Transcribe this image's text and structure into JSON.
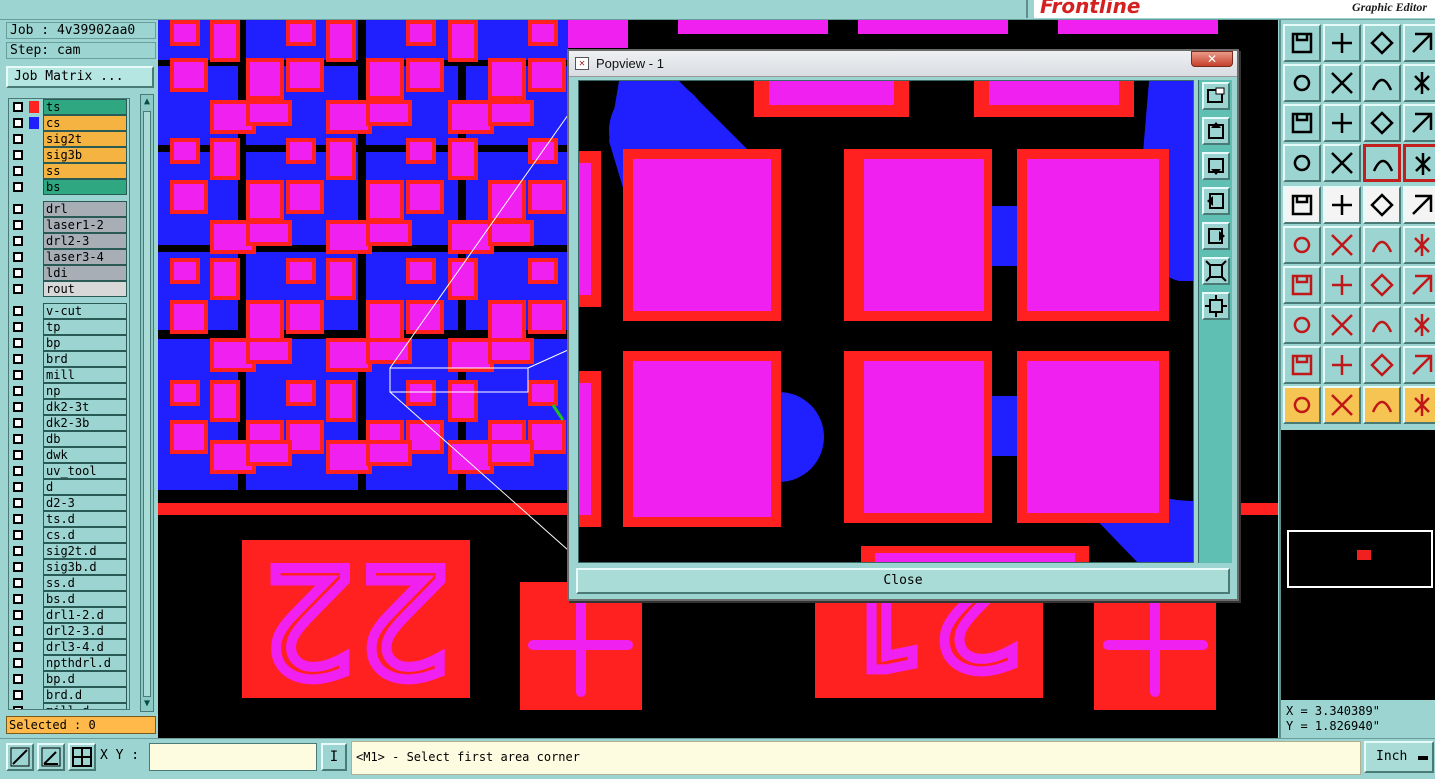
{
  "brand": {
    "logo_text": "Frontline",
    "subtitle": "Graphic Editor"
  },
  "job": {
    "job_line": "Job : 4v39902aa0",
    "step_line": "Step: cam",
    "matrix_button": "Job Matrix ..."
  },
  "layers": {
    "board": [
      {
        "name": "ts",
        "color": "#ff2020",
        "bg": "#2fa882"
      },
      {
        "name": "cs",
        "color": "#2020ff",
        "bg": "#f5b342"
      },
      {
        "name": "sig2t",
        "color": "",
        "bg": "#f5b342"
      },
      {
        "name": "sig3b",
        "color": "",
        "bg": "#f5b342"
      },
      {
        "name": "ss",
        "color": "",
        "bg": "#f5b342"
      },
      {
        "name": "bs",
        "color": "",
        "bg": "#2fa882"
      }
    ],
    "drill": [
      {
        "name": "drl",
        "bg": "#a8aeb6"
      },
      {
        "name": "laser1-2",
        "bg": "#a8aeb6"
      },
      {
        "name": "drl2-3",
        "bg": "#a8aeb6"
      },
      {
        "name": "laser3-4",
        "bg": "#a8aeb6"
      },
      {
        "name": "ldi",
        "bg": "#a8aeb6"
      },
      {
        "name": "rout",
        "bg": "#d8d8d8"
      }
    ],
    "misc": [
      {
        "name": "v-cut"
      },
      {
        "name": "tp"
      },
      {
        "name": "bp"
      },
      {
        "name": "brd"
      },
      {
        "name": "mill"
      },
      {
        "name": "np"
      },
      {
        "name": "dk2-3t"
      },
      {
        "name": "dk2-3b"
      },
      {
        "name": "db"
      },
      {
        "name": "dwk"
      },
      {
        "name": "uv_tool"
      },
      {
        "name": "d"
      },
      {
        "name": "d2-3"
      },
      {
        "name": "ts.d"
      },
      {
        "name": "cs.d"
      },
      {
        "name": "sig2t.d"
      },
      {
        "name": "sig3b.d"
      },
      {
        "name": "ss.d"
      },
      {
        "name": "bs.d"
      },
      {
        "name": "drl1-2.d"
      },
      {
        "name": "drl2-3.d"
      },
      {
        "name": "drl3-4.d"
      },
      {
        "name": "npthdrl.d"
      },
      {
        "name": "bp.d"
      },
      {
        "name": "brd.d"
      },
      {
        "name": "mill.d"
      }
    ]
  },
  "selected": "Selected : 0",
  "popview": {
    "title": "Popview - 1",
    "close_x": "✕",
    "close_button": "Close"
  },
  "canvas": {
    "pad_label_left": "22",
    "pad_label_right": "21"
  },
  "coords": {
    "x": "X = 3.340389\"",
    "y": "Y = 1.826940\""
  },
  "bottom": {
    "xy_label": "X Y :",
    "xy_value": "",
    "enter_label": "I",
    "prompt": "<M1> - Select first area corner",
    "unit": "Inch"
  },
  "colors": {
    "pad": "#f020f0",
    "copper": "#ff2020",
    "plane": "#2020ff",
    "panel": "#9bd4d0"
  }
}
